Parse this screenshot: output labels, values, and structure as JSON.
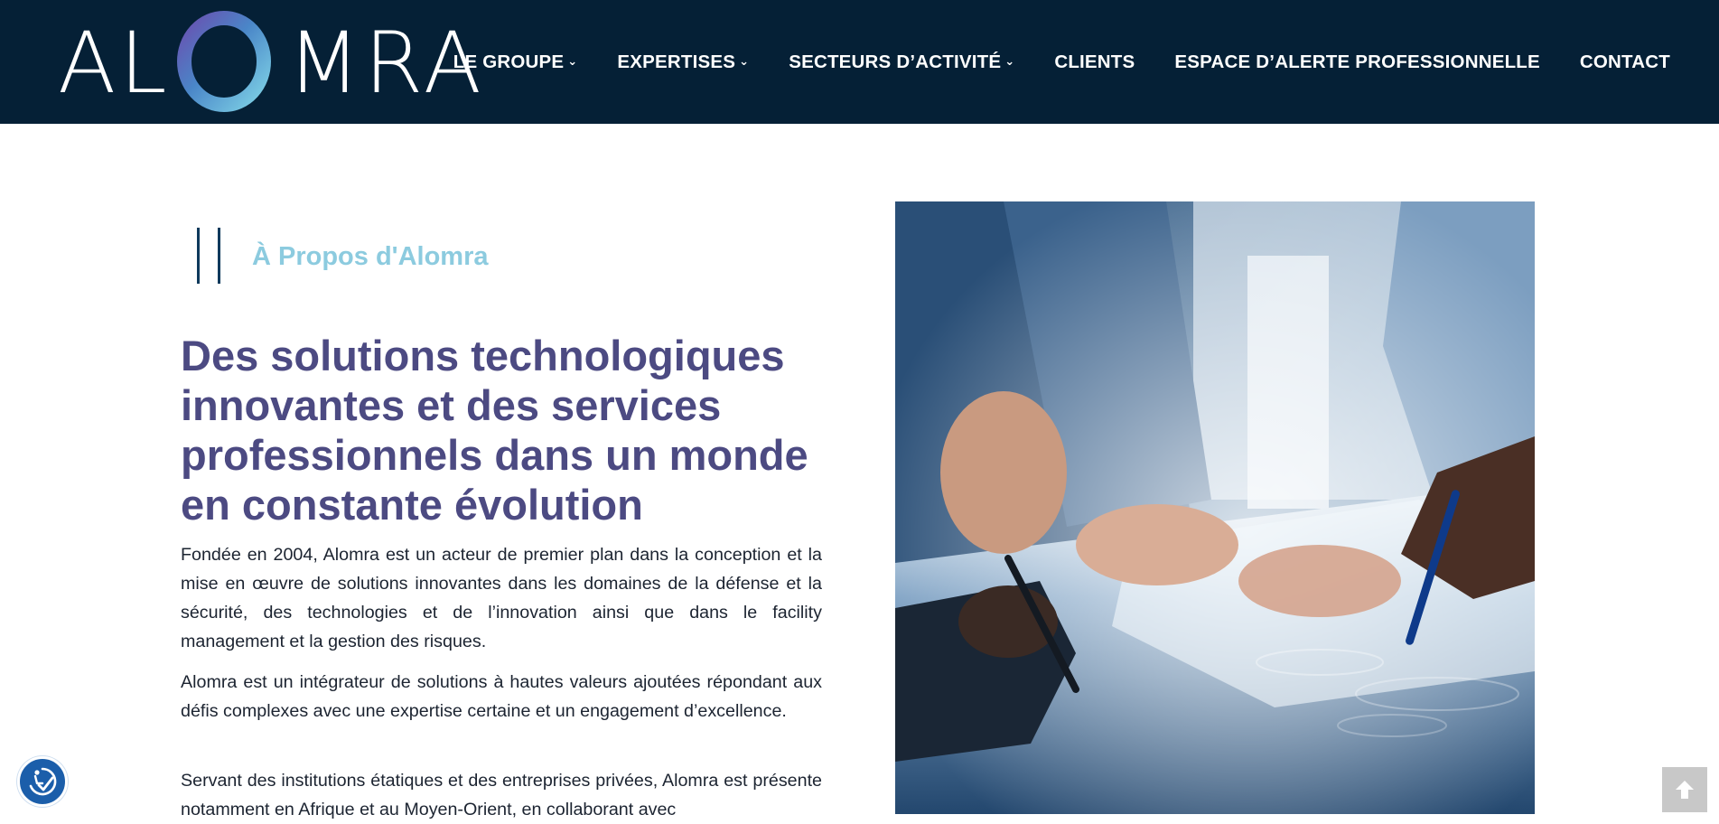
{
  "header": {
    "logo_alt": "ALOMRA",
    "logo_left": "AL",
    "logo_right": "MRA",
    "nav": [
      {
        "label": "LE GROUPE",
        "dropdown": true
      },
      {
        "label": "EXPERTISES",
        "dropdown": true
      },
      {
        "label": "SECTEURS D’ACTIVITÉ",
        "dropdown": true
      },
      {
        "label": "CLIENTS",
        "dropdown": false
      },
      {
        "label": "ESPACE D’ALERTE PROFESSIONNELLE",
        "dropdown": false
      },
      {
        "label": "CONTACT",
        "dropdown": false
      }
    ],
    "dropdown_glyph": "⌄"
  },
  "about": {
    "section_label": "À Propos d'Alomra",
    "headline": "Des solutions technologiques innovantes et des services professionnels dans un monde en constante évolution",
    "paragraphs": [
      "Fondée en 2004, Alomra est un acteur de premier plan  dans la conception et la mise en œuvre de solutions  innovantes dans les domaines de la défense et la sécurité,  des technologies et de l’innovation ainsi que dans le  facility management et la gestion des risques.",
      "Alomra est un intégrateur de solutions à hautes valeurs  ajoutées répondant aux défis complexes avec une  expertise certaine et un engagement d’excellence.",
      "Servant des institutions étatiques et des entreprises  privées, Alomra est présente notamment en Afrique et au  Moyen-Orient, en collaborant avec"
    ]
  },
  "widgets": {
    "accessibility_icon": "accessibility-check-icon",
    "scroll_top_icon": "arrow-up-icon"
  },
  "colors": {
    "header_bg": "#052036",
    "headline": "#4c4a82",
    "label": "#8ccbdf",
    "accessibility_btn": "#1b5eaa"
  }
}
